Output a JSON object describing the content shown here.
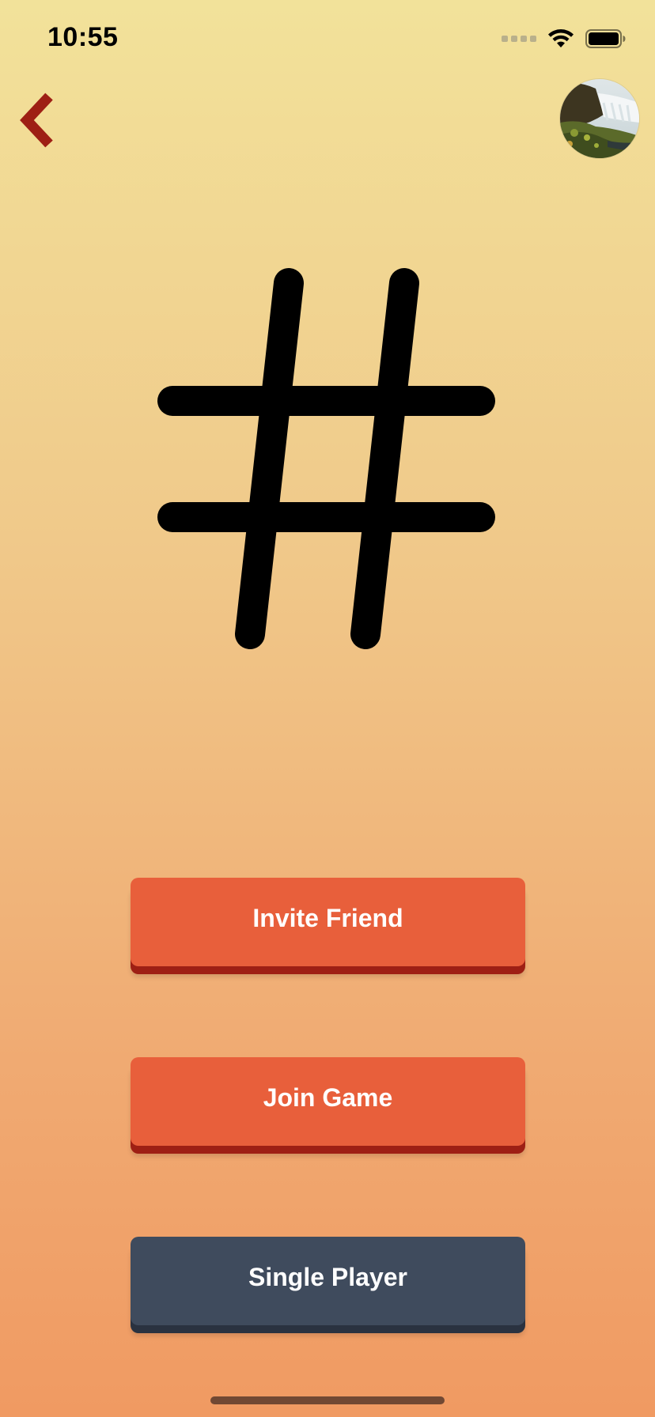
{
  "status_bar": {
    "time": "10:55"
  },
  "nav": {
    "back_icon": "chevron-left-icon",
    "avatar_icon": "waterfall-photo-avatar"
  },
  "logo": {
    "icon": "hash-icon"
  },
  "buttons": {
    "invite_friend": "Invite Friend",
    "join_game": "Join Game",
    "single_player": "Single Player"
  },
  "colors": {
    "primary_button": "#e85f3b",
    "primary_button_shadow": "#9e1f14",
    "secondary_button": "#3f4b5d",
    "back_chevron": "#9e1f14",
    "gradient_top": "#f2e29a",
    "gradient_bottom": "#f09a62"
  }
}
